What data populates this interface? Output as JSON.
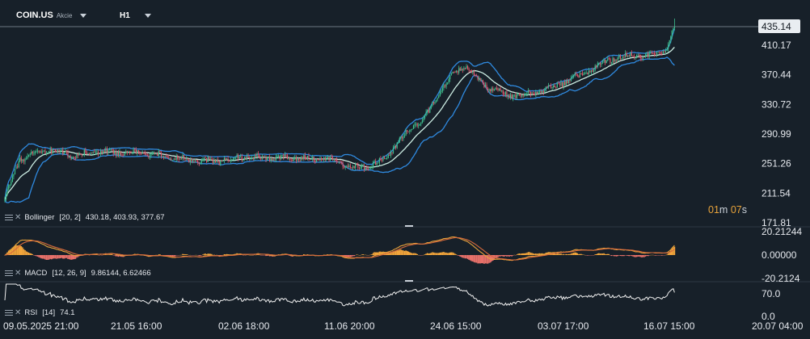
{
  "header": {
    "symbol": "COIN.US",
    "asset_type": "Akcie",
    "timeframe": "H1"
  },
  "timer": {
    "value": "01m 07s",
    "minutes": "01",
    "m": "m",
    "seconds": "07",
    "s": "s"
  },
  "colors": {
    "background": "#172029",
    "bull": "#3fbf8f",
    "bear": "#e0566a",
    "bb": "#2f8ae0",
    "bb_mid": "#cdeee4",
    "macd_line": "#e7a23c",
    "macd_signal": "#d76a3d",
    "macd_pos": "#f2a53b",
    "macd_neg": "#e8716a",
    "rsi": "#f2f2f2",
    "grid": "#222c36",
    "text": "#e6e9ee"
  },
  "price_pane": {
    "y_labels": [
      "435.14",
      "410.17",
      "370.44",
      "330.72",
      "290.99",
      "251.26",
      "211.54",
      "171.81"
    ],
    "current_price": "435.14",
    "indicator": {
      "name": "Bollinger",
      "params": "[20, 2]",
      "values": "430.18,  403.93,  377.67"
    }
  },
  "macd_pane": {
    "y_labels": [
      "20.21244",
      "0.00000",
      "-20.2124"
    ],
    "indicator": {
      "name": "MACD",
      "params": "[12, 26, 9]",
      "values": "9.86144,  6.62466"
    }
  },
  "rsi_pane": {
    "y_labels": [
      "70.0",
      "0.0"
    ],
    "indicator": {
      "name": "RSI",
      "params": "[14]",
      "values": "74.1"
    }
  },
  "x_labels": [
    "09.05.2025  21:00",
    "21.05  16:00",
    "02.06  18:00",
    "11.06  20:00",
    "24.06  15:00",
    "03.07  17:00",
    "16.07  15:00",
    "20.07  04:00"
  ],
  "chart_data": {
    "type": "candlestick",
    "symbol": "COIN.US",
    "timeframe": "H1",
    "x_ticks": [
      "09.05.2025  21:00",
      "21.05  16:00",
      "02.06  18:00",
      "11.06  20:00",
      "24.06  15:00",
      "03.07  17:00",
      "16.07  15:00",
      "20.07  04:00"
    ],
    "price_axis_ticks": [
      435.14,
      410.17,
      370.44,
      330.72,
      290.99,
      251.26,
      211.54,
      171.81
    ],
    "close_path": [
      {
        "t": 0,
        "p": 204
      },
      {
        "t": 12,
        "p": 258
      },
      {
        "t": 35,
        "p": 270
      },
      {
        "t": 55,
        "p": 262
      },
      {
        "t": 75,
        "p": 267
      },
      {
        "t": 100,
        "p": 266
      },
      {
        "t": 125,
        "p": 262
      },
      {
        "t": 145,
        "p": 256
      },
      {
        "t": 165,
        "p": 254
      },
      {
        "t": 190,
        "p": 260
      },
      {
        "t": 215,
        "p": 259
      },
      {
        "t": 240,
        "p": 258
      },
      {
        "t": 260,
        "p": 256
      },
      {
        "t": 280,
        "p": 244
      },
      {
        "t": 300,
        "p": 256
      },
      {
        "t": 320,
        "p": 296
      },
      {
        "t": 335,
        "p": 318
      },
      {
        "t": 350,
        "p": 362
      },
      {
        "t": 365,
        "p": 383
      },
      {
        "t": 380,
        "p": 356
      },
      {
        "t": 400,
        "p": 342
      },
      {
        "t": 420,
        "p": 345
      },
      {
        "t": 440,
        "p": 358
      },
      {
        "t": 460,
        "p": 372
      },
      {
        "t": 480,
        "p": 392
      },
      {
        "t": 500,
        "p": 398
      },
      {
        "t": 510,
        "p": 394
      },
      {
        "t": 525,
        "p": 408
      },
      {
        "t": 531,
        "p": 435
      }
    ],
    "bollinger": {
      "period": 20,
      "stddev": 2,
      "upper": 430.18,
      "middle": 403.93,
      "lower": 377.67
    },
    "macd": {
      "fast": 12,
      "slow": 26,
      "signal": 9,
      "macd": 9.86144,
      "signal_value": 6.62466,
      "ylim": [
        -20.2124,
        20.21244
      ]
    },
    "rsi": {
      "period": 14,
      "value": 74.1,
      "ylim": [
        0,
        100
      ],
      "level": 70
    }
  }
}
